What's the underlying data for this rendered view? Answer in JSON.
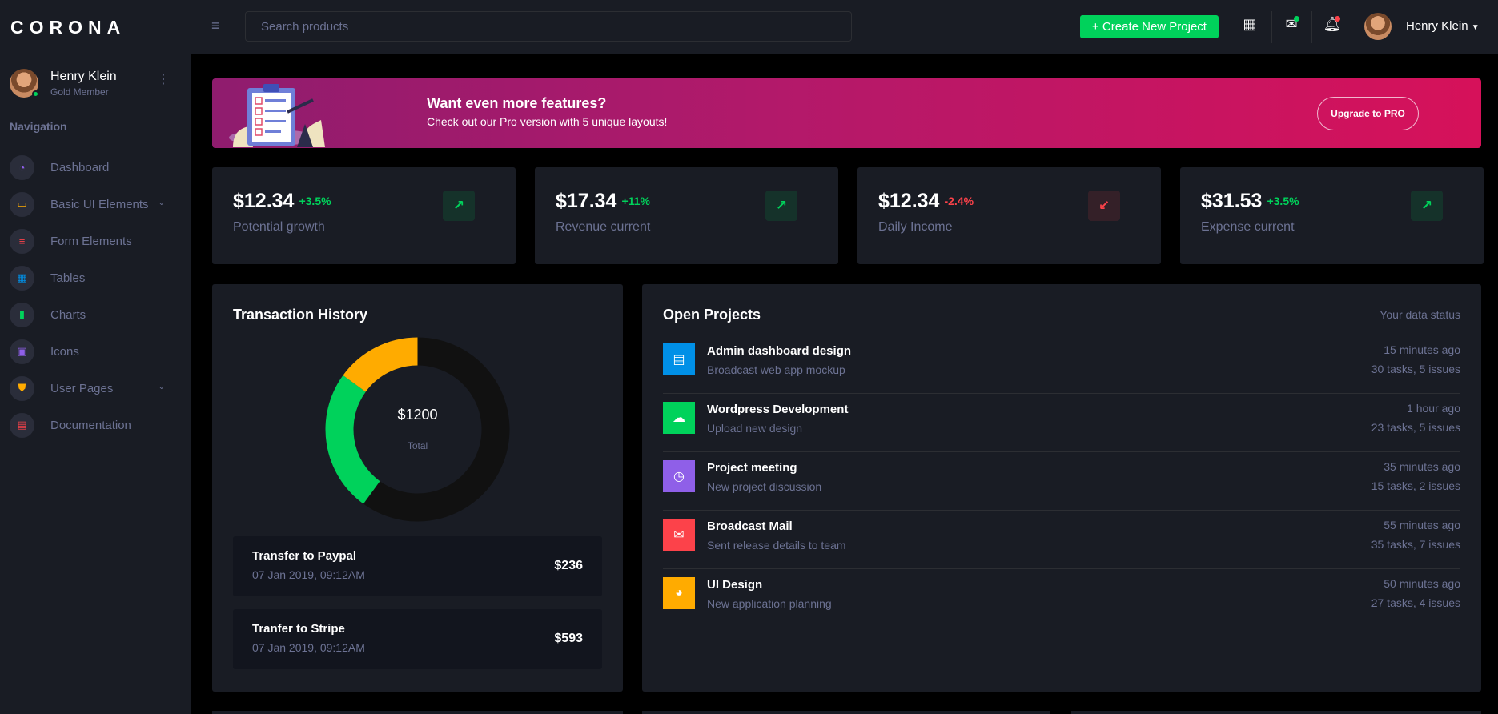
{
  "sidebar": {
    "brand": "CORONA",
    "profile": {
      "name": "Henry Klein",
      "role": "Gold Member"
    },
    "nav_title": "Navigation",
    "items": [
      {
        "label": "Dashboard",
        "icon": "speedometer-icon",
        "color": "#8f5fe8",
        "glyph": "◔"
      },
      {
        "label": "Basic UI Elements",
        "icon": "laptop-icon",
        "color": "#ffab00",
        "glyph": "▭",
        "expandable": true
      },
      {
        "label": "Form Elements",
        "icon": "playlist-icon",
        "color": "#fc424a",
        "glyph": "≡"
      },
      {
        "label": "Tables",
        "icon": "table-icon",
        "color": "#0090e7",
        "glyph": "▦"
      },
      {
        "label": "Charts",
        "icon": "chart-bar-icon",
        "color": "#00d25b",
        "glyph": "▮"
      },
      {
        "label": "Icons",
        "icon": "contacts-icon",
        "color": "#8f5fe8",
        "glyph": "▣"
      },
      {
        "label": "User Pages",
        "icon": "security-icon",
        "color": "#ffab00",
        "glyph": "⛊",
        "expandable": true
      },
      {
        "label": "Documentation",
        "icon": "file-document-icon",
        "color": "#fc424a",
        "glyph": "▤"
      }
    ]
  },
  "navbar": {
    "search_placeholder": "Search products",
    "create_label": "+ Create New Project",
    "user_name": "Henry Klein"
  },
  "banner": {
    "title": "Want even more features?",
    "subtitle": "Check out our Pro version with 5 unique layouts!",
    "button": "Upgrade to PRO"
  },
  "stats": [
    {
      "value": "$12.34",
      "change": "+3.5%",
      "trend": "up",
      "label": "Potential growth"
    },
    {
      "value": "$17.34",
      "change": "+11%",
      "trend": "up",
      "label": "Revenue current"
    },
    {
      "value": "$12.34",
      "change": "-2.4%",
      "trend": "down",
      "label": "Daily Income"
    },
    {
      "value": "$31.53",
      "change": "+3.5%",
      "trend": "up",
      "label": "Expense current"
    }
  ],
  "transactions": {
    "title": "Transaction History",
    "total_value": "$1200",
    "total_label": "Total",
    "segments": [
      {
        "share": 0.6,
        "color": "#111111"
      },
      {
        "share": 0.25,
        "color": "#00d25b"
      },
      {
        "share": 0.15,
        "color": "#ffab00"
      }
    ],
    "rows": [
      {
        "title": "Transfer to Paypal",
        "date": "07 Jan 2019, 09:12AM",
        "amount": "$236"
      },
      {
        "title": "Tranfer to Stripe",
        "date": "07 Jan 2019, 09:12AM",
        "amount": "$593"
      }
    ]
  },
  "projects": {
    "title": "Open Projects",
    "status_label": "Your data status",
    "rows": [
      {
        "title": "Admin dashboard design",
        "subtitle": "Broadcast web app mockup",
        "time": "15 minutes ago",
        "tasks": "30 tasks, 5 issues",
        "icon": "file-document-icon",
        "glyph": "▤",
        "color": "#0090e7"
      },
      {
        "title": "Wordpress Development",
        "subtitle": "Upload new design",
        "time": "1 hour ago",
        "tasks": "23 tasks, 5 issues",
        "icon": "cloud-upload-icon",
        "glyph": "☁",
        "color": "#00d25b"
      },
      {
        "title": "Project meeting",
        "subtitle": "New project discussion",
        "time": "35 minutes ago",
        "tasks": "15 tasks, 2 issues",
        "icon": "clock-icon",
        "glyph": "◷",
        "color": "#8f5fe8"
      },
      {
        "title": "Broadcast Mail",
        "subtitle": "Sent release details to team",
        "time": "55 minutes ago",
        "tasks": "35 tasks, 7 issues",
        "icon": "email-open-icon",
        "glyph": "✉",
        "color": "#fc424a"
      },
      {
        "title": "UI Design",
        "subtitle": "New application planning",
        "time": "50 minutes ago",
        "tasks": "27 tasks, 4 issues",
        "icon": "chart-pie-icon",
        "glyph": "◕",
        "color": "#ffab00"
      }
    ]
  }
}
